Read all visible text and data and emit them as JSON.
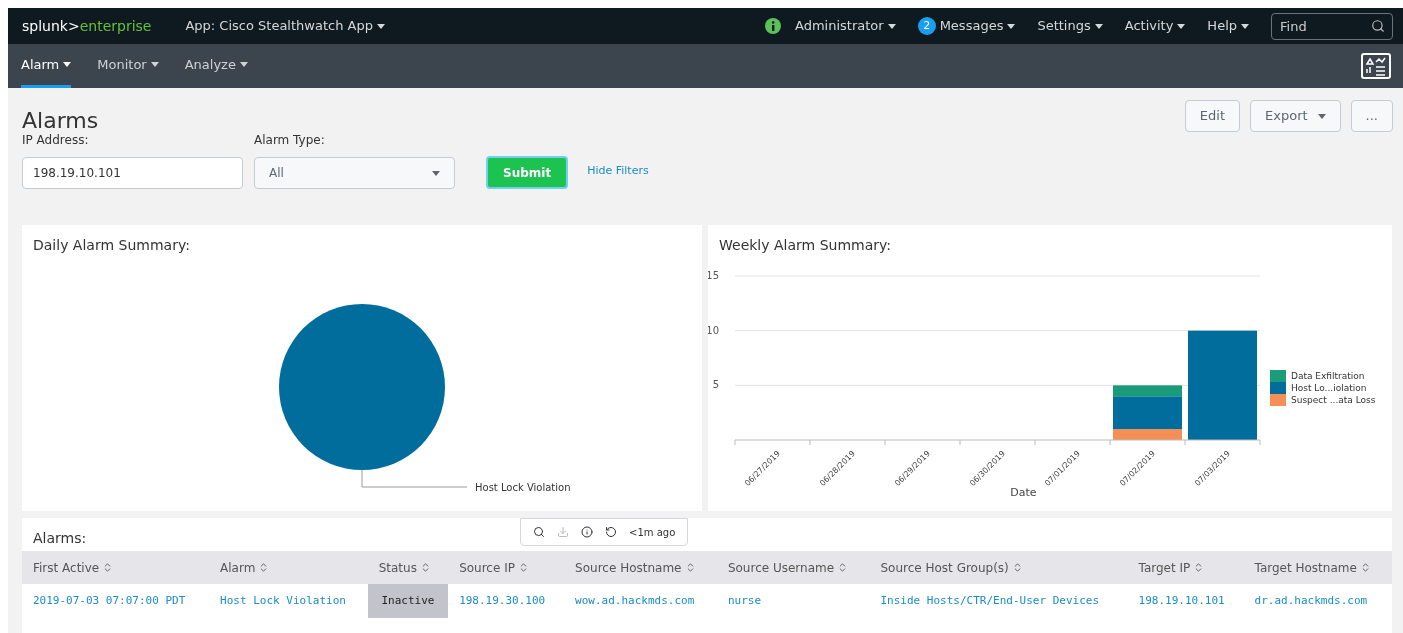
{
  "header": {
    "logo_main": "splunk>",
    "logo_accent": "enterprise",
    "app": "App: Cisco Stealthwatch App",
    "menus": [
      {
        "label": "Administrator",
        "kind": "status"
      },
      {
        "label": "Messages",
        "kind": "count",
        "count": "2"
      },
      {
        "label": "Settings",
        "kind": "plain"
      },
      {
        "label": "Activity",
        "kind": "plain"
      },
      {
        "label": "Help",
        "kind": "plain"
      }
    ],
    "search": {
      "placeholder": "Find"
    }
  },
  "nav": [
    {
      "label": "Alarm",
      "selected": true
    },
    {
      "label": "Monitor",
      "selected": false
    },
    {
      "label": "Analyze",
      "selected": false
    }
  ],
  "page": {
    "title": "Alarms",
    "actions": [
      {
        "label": "Edit",
        "kind": "plain"
      },
      {
        "label": "Export",
        "kind": "menu"
      },
      {
        "label": "...",
        "kind": "plain"
      }
    ]
  },
  "filters": {
    "ip": {
      "label": "IP Address:",
      "value": "198.19.10.101"
    },
    "type": {
      "label": "Alarm Type:",
      "value": "All"
    },
    "submit": "Submit",
    "hide": "Hide Filters"
  },
  "daily": {
    "title": "Daily Alarm Summary:",
    "slice_label": "Host Lock Violation"
  },
  "weekly": {
    "title": "Weekly Alarm Summary:",
    "chart_data": {
      "type": "bar",
      "stacked": true,
      "legend": "right",
      "xlabel": "Date",
      "categories": [
        "06/27/2019",
        "06/28/2019",
        "06/29/2019",
        "06/30/2019",
        "07/01/2019",
        "07/02/2019",
        "07/03/2019"
      ],
      "ylim": [
        0,
        15
      ],
      "yticks": [
        5,
        10,
        15
      ],
      "series": [
        {
          "name": "Data Exfiltration",
          "color": "#1a9c7b",
          "values": [
            null,
            null,
            null,
            null,
            null,
            1,
            null
          ]
        },
        {
          "name": "Host Lo...iolation",
          "color": "#006d9c",
          "values": [
            null,
            null,
            null,
            null,
            null,
            3,
            10
          ]
        },
        {
          "name": "Suspect ...ata Loss",
          "color": "#f58f55",
          "values": [
            null,
            null,
            null,
            null,
            null,
            1,
            null
          ]
        }
      ]
    }
  },
  "toolbar": {
    "age": "<1m ago"
  },
  "table": {
    "title": "Alarms:",
    "columns": [
      "First Active",
      "Alarm",
      "Status",
      "Source IP",
      "Source Hostname",
      "Source Username",
      "Source Host Group(s)",
      "Target IP",
      "Target Hostname"
    ],
    "rows": [
      {
        "cells": [
          {
            "text": "2019-07-03 07:07:00 PDT",
            "kind": "link"
          },
          {
            "text": "Host Lock Violation",
            "kind": "link"
          },
          {
            "text": "Inactive",
            "kind": "status"
          },
          {
            "text": "198.19.30.100",
            "kind": "link"
          },
          {
            "text": "wow.ad.hackmds.com",
            "kind": "link"
          },
          {
            "text": "nurse",
            "kind": "link"
          },
          {
            "text": "Inside Hosts/CTR/End-User Devices",
            "kind": "link"
          },
          {
            "text": "198.19.10.101",
            "kind": "link"
          },
          {
            "text": "dr.ad.hackmds.com",
            "kind": "link"
          }
        ]
      }
    ]
  }
}
